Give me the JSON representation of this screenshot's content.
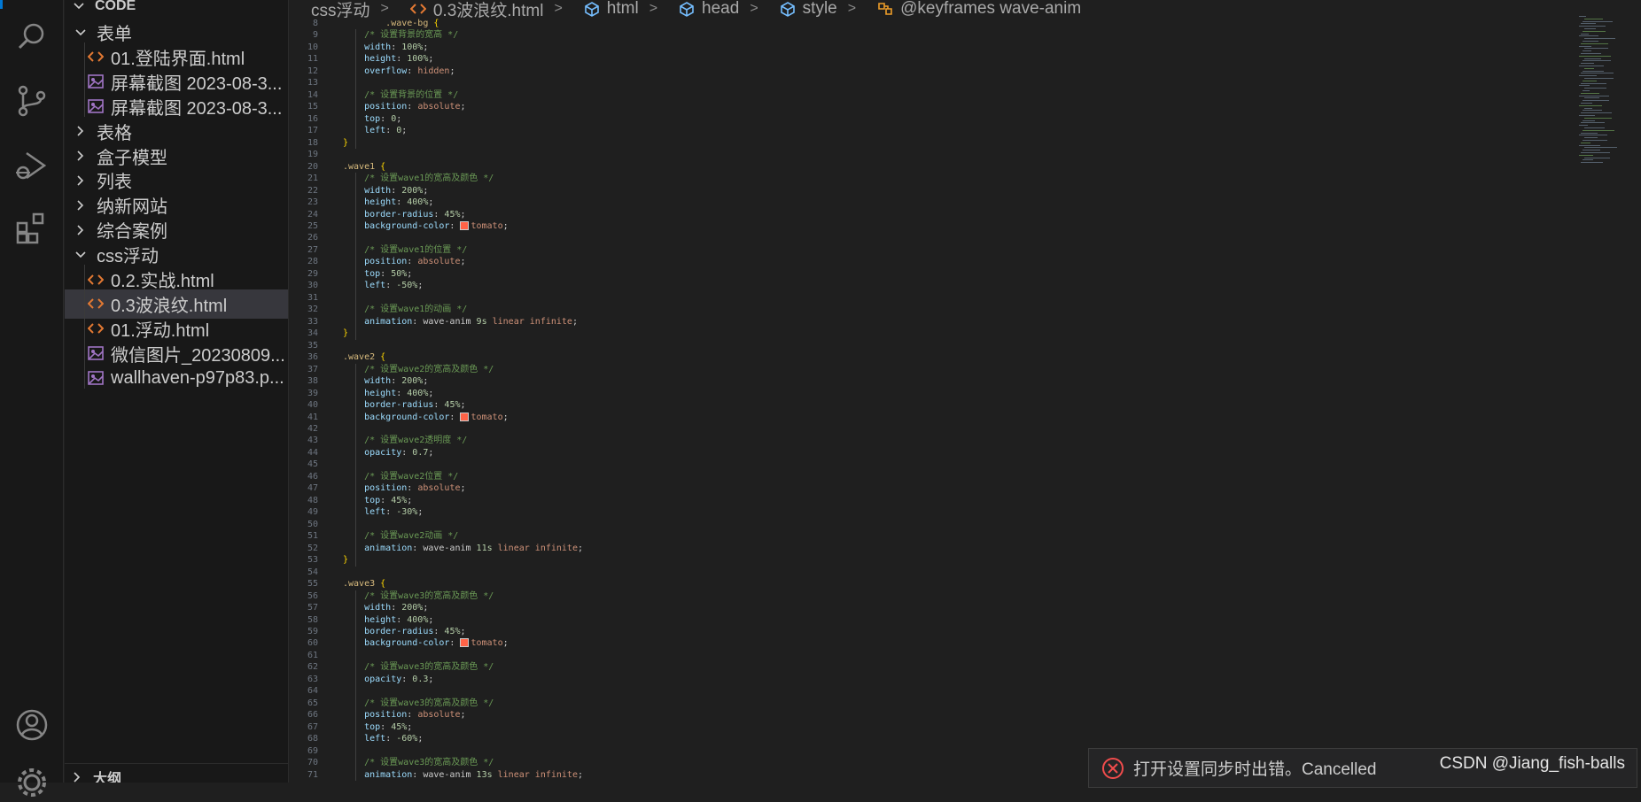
{
  "sidebar": {
    "section_title": "CODE",
    "outline_title": "大纲",
    "items": [
      {
        "label": "表单",
        "kind": "folder-open"
      },
      {
        "label": "01.登陆界面.html",
        "kind": "html"
      },
      {
        "label": "屏幕截图 2023-08-3...",
        "kind": "image"
      },
      {
        "label": "屏幕截图 2023-08-3...",
        "kind": "image"
      },
      {
        "label": "表格",
        "kind": "folder"
      },
      {
        "label": "盒子模型",
        "kind": "folder"
      },
      {
        "label": "列表",
        "kind": "folder"
      },
      {
        "label": "纳新网站",
        "kind": "folder"
      },
      {
        "label": "综合案例",
        "kind": "folder"
      },
      {
        "label": "css浮动",
        "kind": "folder-open"
      },
      {
        "label": "0.2.实战.html",
        "kind": "html"
      },
      {
        "label": "0.3波浪纹.html",
        "kind": "html",
        "selected": true
      },
      {
        "label": "01.浮动.html",
        "kind": "html"
      },
      {
        "label": "微信图片_20230809...",
        "kind": "image"
      },
      {
        "label": "wallhaven-p97p83.p...",
        "kind": "image"
      }
    ]
  },
  "breadcrumb": [
    "css浮动",
    "0.3波浪纹.html",
    "html",
    "head",
    "style",
    "@keyframes wave-anim"
  ],
  "editor": {
    "lines": [
      {
        "n": "8",
        "t": "        .wave-bg {"
      },
      {
        "n": "9",
        "t": "    /* 设置背景的宽高 */"
      },
      {
        "n": "10",
        "t": "    width: 100%;"
      },
      {
        "n": "11",
        "t": "    height: 100%;"
      },
      {
        "n": "12",
        "t": "    overflow: hidden;"
      },
      {
        "n": "13",
        "t": ""
      },
      {
        "n": "14",
        "t": "    /* 设置背景的位置 */"
      },
      {
        "n": "15",
        "t": "    position: absolute;"
      },
      {
        "n": "16",
        "t": "    top: 0;"
      },
      {
        "n": "17",
        "t": "    left: 0;"
      },
      {
        "n": "18",
        "t": "}"
      },
      {
        "n": "19",
        "t": ""
      },
      {
        "n": "20",
        "t": ".wave1 {"
      },
      {
        "n": "21",
        "t": "    /* 设置wave1的宽高及颜色 */"
      },
      {
        "n": "22",
        "t": "    width: 200%;"
      },
      {
        "n": "23",
        "t": "    height: 400%;"
      },
      {
        "n": "24",
        "t": "    border-radius: 45%;"
      },
      {
        "n": "25",
        "t": "    background-color: tomato;"
      },
      {
        "n": "26",
        "t": ""
      },
      {
        "n": "27",
        "t": "    /* 设置wave1的位置 */"
      },
      {
        "n": "28",
        "t": "    position: absolute;"
      },
      {
        "n": "29",
        "t": "    top: 50%;"
      },
      {
        "n": "30",
        "t": "    left: -50%;"
      },
      {
        "n": "31",
        "t": ""
      },
      {
        "n": "32",
        "t": "    /* 设置wave1的动画 */"
      },
      {
        "n": "33",
        "t": "    animation: wave-anim 9s linear infinite;"
      },
      {
        "n": "34",
        "t": "}"
      },
      {
        "n": "35",
        "t": ""
      },
      {
        "n": "36",
        "t": ".wave2 {"
      },
      {
        "n": "37",
        "t": "    /* 设置wave2的宽高及颜色 */"
      },
      {
        "n": "38",
        "t": "    width: 200%;"
      },
      {
        "n": "39",
        "t": "    height: 400%;"
      },
      {
        "n": "40",
        "t": "    border-radius: 45%;"
      },
      {
        "n": "41",
        "t": "    background-color: tomato;"
      },
      {
        "n": "42",
        "t": ""
      },
      {
        "n": "43",
        "t": "    /* 设置wave2透明度 */"
      },
      {
        "n": "44",
        "t": "    opacity: 0.7;"
      },
      {
        "n": "45",
        "t": ""
      },
      {
        "n": "46",
        "t": "    /* 设置wave2位置 */"
      },
      {
        "n": "47",
        "t": "    position: absolute;"
      },
      {
        "n": "48",
        "t": "    top: 45%;"
      },
      {
        "n": "49",
        "t": "    left: -30%;"
      },
      {
        "n": "50",
        "t": ""
      },
      {
        "n": "51",
        "t": "    /* 设置wave2动画 */"
      },
      {
        "n": "52",
        "t": "    animation: wave-anim 11s linear infinite;"
      },
      {
        "n": "53",
        "t": "}"
      },
      {
        "n": "54",
        "t": ""
      },
      {
        "n": "55",
        "t": ".wave3 {"
      },
      {
        "n": "56",
        "t": "    /* 设置wave3的宽高及颜色 */"
      },
      {
        "n": "57",
        "t": "    width: 200%;"
      },
      {
        "n": "58",
        "t": "    height: 400%;"
      },
      {
        "n": "59",
        "t": "    border-radius: 45%;"
      },
      {
        "n": "60",
        "t": "    background-color: tomato;"
      },
      {
        "n": "61",
        "t": ""
      },
      {
        "n": "62",
        "t": "    /* 设置wave3的宽高及颜色 */"
      },
      {
        "n": "63",
        "t": "    opacity: 0.3;"
      },
      {
        "n": "64",
        "t": ""
      },
      {
        "n": "65",
        "t": "    /* 设置wave3的宽高及颜色 */"
      },
      {
        "n": "66",
        "t": "    position: absolute;"
      },
      {
        "n": "67",
        "t": "    top: 45%;"
      },
      {
        "n": "68",
        "t": "    left: -60%;"
      },
      {
        "n": "69",
        "t": ""
      },
      {
        "n": "70",
        "t": "    /* 设置wave3的宽高及颜色 */"
      },
      {
        "n": "71",
        "t": "    animation: wave-anim 13s linear infinite;"
      }
    ]
  },
  "notification": {
    "text": "打开设置同步时出错。Cancelled"
  },
  "watermark": "CSDN @Jiang_fish-balls",
  "colors": {
    "accent": "#0078d4",
    "error": "#f14c4c",
    "swatch": "#ff6347"
  }
}
